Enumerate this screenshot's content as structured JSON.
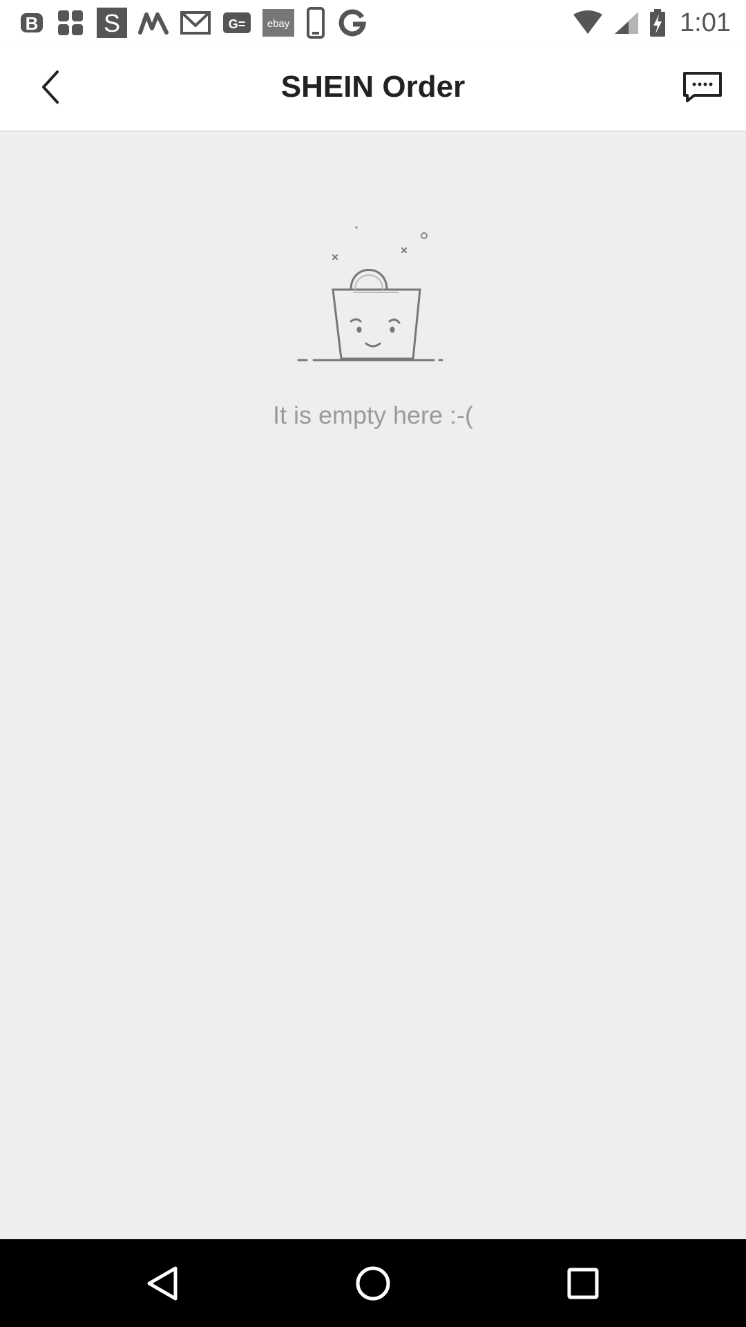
{
  "status_bar": {
    "notification_icons": [
      "b-app-icon",
      "puzzle-app-icon",
      "s-app-icon",
      "m-app-icon",
      "gmail-icon",
      "ge-app-icon",
      "ebay-icon",
      "phone-app-icon",
      "g-app-icon"
    ],
    "ebay_label": "ebay",
    "time": "1:01"
  },
  "app_bar": {
    "title": "SHEIN Order",
    "back_icon": "chevron-left-icon",
    "chat_icon": "chat-bubble-icon"
  },
  "empty_state": {
    "illustration": "sad-shopping-bag",
    "message": "It is empty here :-("
  },
  "nav_bar": {
    "buttons": [
      "back-triangle-icon",
      "home-circle-icon",
      "recents-square-icon"
    ]
  }
}
